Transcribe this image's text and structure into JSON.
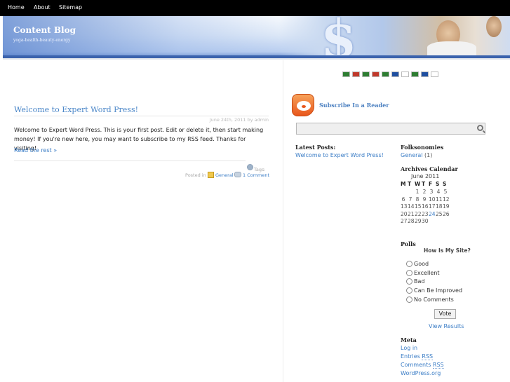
{
  "nav": {
    "items": [
      "Home",
      "About",
      "Sitemap"
    ]
  },
  "header": {
    "title": "Content Blog",
    "tagline": "yoga-health-beauty-energy",
    "dollar_glyph": "$"
  },
  "flags": [
    {
      "name": "arabic-flag",
      "color": "#2e7d32"
    },
    {
      "name": "german-flag",
      "color": "#c0392b"
    },
    {
      "name": "portuguese-flag",
      "color": "#2e7d32"
    },
    {
      "name": "chinese-flag",
      "color": "#c0392b"
    },
    {
      "name": "italian-flag",
      "color": "#2e7d32"
    },
    {
      "name": "russian-flag",
      "color": "#1f4fa0"
    },
    {
      "name": "japanese-flag",
      "color": "#ffffff"
    },
    {
      "name": "mexican-flag",
      "color": "#2e7d32"
    },
    {
      "name": "french-flag",
      "color": "#1f4fa0"
    },
    {
      "name": "korean-flag",
      "color": "#ffffff"
    }
  ],
  "post": {
    "title": "Welcome to Expert Word Press!",
    "meta": "June 24th, 2011 by admin",
    "body": "Welcome to Expert Word Press. This is your first post. Edit or delete it, then start making money! If you're new here, you may want to subscribe to my RSS feed. Thanks for visiting!",
    "more": "Read the rest »",
    "tags_label": "Tags:",
    "posted_in": "Posted in",
    "category": "General",
    "comments": "1 Comment"
  },
  "sidebar": {
    "subscribe": "Subscribe In a Reader",
    "latest_title": "Latest Posts:",
    "latest_link": "Welcome to Expert Word Press!",
    "folk_title": "Folksonomies",
    "folk_link": "General",
    "folk_count": "(1)",
    "archives_title": "Archives Calendar",
    "calendar": {
      "caption": "June 2011",
      "days": [
        "M",
        "T",
        "W",
        "T",
        "F",
        "S",
        "S"
      ],
      "weeks": [
        [
          "",
          "",
          "1",
          "2",
          "3",
          "4",
          "5"
        ],
        [
          "6",
          "7",
          "8",
          "9",
          "10",
          "11",
          "12"
        ],
        [
          "13",
          "14",
          "15",
          "16",
          "17",
          "18",
          "19"
        ],
        [
          "20",
          "21",
          "22",
          "23",
          "24",
          "25",
          "26"
        ],
        [
          "27",
          "28",
          "29",
          "30",
          "",
          "",
          ""
        ]
      ],
      "linked_day": "24"
    },
    "polls_title": "Polls",
    "poll_question": "How Is My Site?",
    "poll_options": [
      "Good",
      "Excellent",
      "Bad",
      "Can Be Improved",
      "No Comments"
    ],
    "vote": "Vote",
    "view_results": "View Results",
    "meta_title": "Meta",
    "meta_links": [
      "Log in",
      "Entries RSS",
      "Comments RSS",
      "WordPress.org"
    ]
  }
}
